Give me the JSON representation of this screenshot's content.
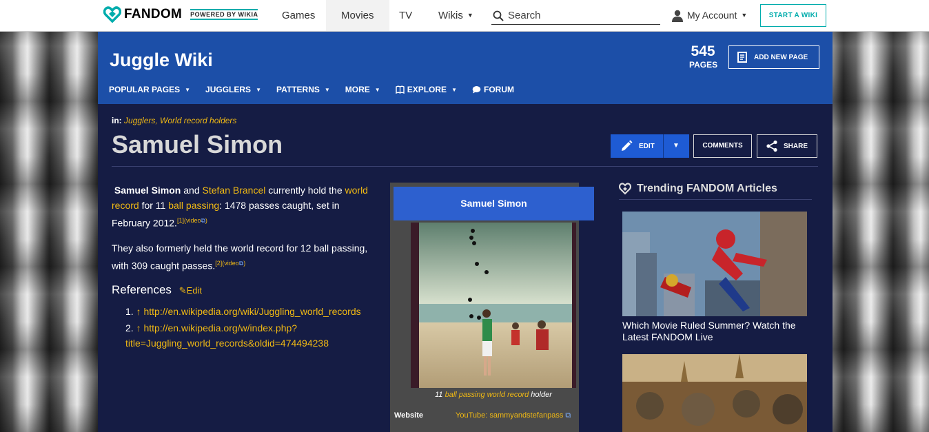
{
  "global_nav": {
    "logo_text": "FANDOM",
    "powered_text": "POWERED BY WIKIA",
    "links": [
      "Games",
      "Movies",
      "TV",
      "Wikis"
    ],
    "search_placeholder": "Search",
    "account_label": "My Account",
    "start_wiki_label": "START A WIKI"
  },
  "wiki": {
    "title": "Juggle Wiki",
    "page_count": "545",
    "pages_label": "PAGES",
    "add_page_label": "ADD NEW PAGE",
    "local_nav": [
      "POPULAR PAGES",
      "JUGGLERS",
      "PATTERNS",
      "MORE",
      "EXPLORE",
      "FORUM"
    ]
  },
  "article": {
    "categories_prefix": "in:",
    "categories": "Jugglers, World record holders",
    "title": "Samuel Simon",
    "edit_label": "EDIT",
    "comments_label": "COMMENTS",
    "share_label": "SHARE",
    "p1": {
      "name1": "Samuel Simon",
      "and": " and ",
      "name2": "Stefan Brancel",
      "t1": " currently hold the ",
      "link1": "world record",
      "t2": " for 11 ",
      "link2": "ball passing",
      "t3": ": 1478 passes caught, set in February 2012.",
      "ref": "[1]",
      "video": "(video"
    },
    "p2": {
      "text": "They also formerly held the world record for 12 ball passing, with 309 caught passes.",
      "ref": "[2]",
      "video": "(video"
    },
    "references_heading": "References",
    "references_edit": "Edit",
    "references": [
      {
        "num": "1.",
        "arrow": "↑",
        "text": "http://en.wikipedia.org/wiki/Juggling_world_records"
      },
      {
        "num": "2.",
        "arrow": "↑",
        "text": "http://en.wikipedia.org/w/index.php?title=Juggling_world_records&oldid=474494238"
      }
    ]
  },
  "infobox": {
    "title": "Samuel Simon",
    "caption_pre": "11 ",
    "caption_link": "ball passing world record",
    "caption_post": " holder",
    "website_label": "Website",
    "website_value": "YouTube: sammyandstefanpass"
  },
  "rail": {
    "title": "Trending FANDOM Articles",
    "card1_caption": "Which Movie Ruled Summer? Watch the Latest FANDOM Live"
  }
}
